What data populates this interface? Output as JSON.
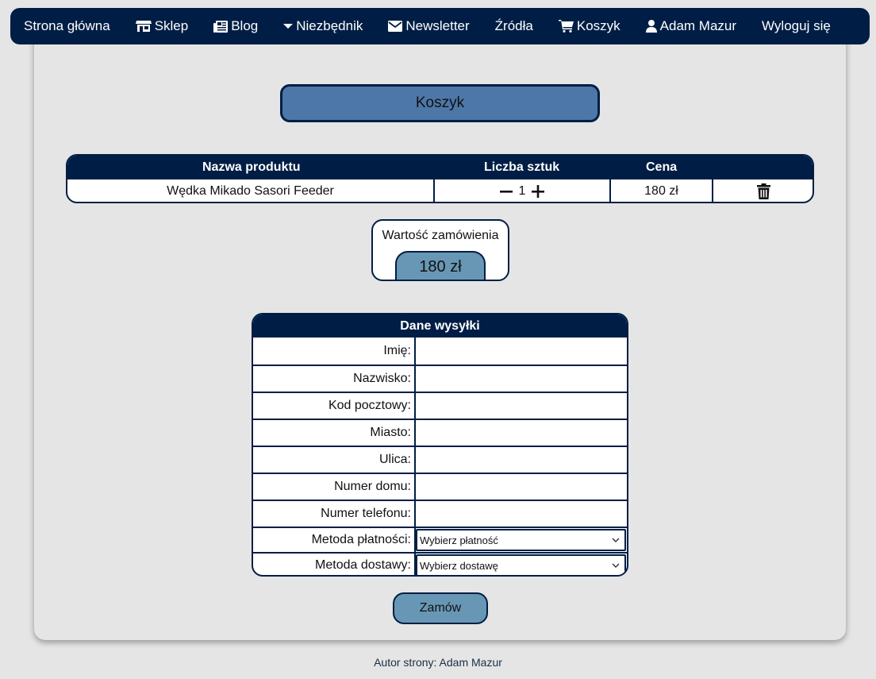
{
  "nav": {
    "items": [
      {
        "label": "Strona główna",
        "icon": ""
      },
      {
        "label": "Sklep",
        "icon": "store-icon"
      },
      {
        "label": "Blog",
        "icon": "newspaper-icon"
      },
      {
        "label": "Niezbędnik",
        "icon": "caret-down-icon"
      },
      {
        "label": "Newsletter",
        "icon": "envelope-icon"
      },
      {
        "label": "Źródła",
        "icon": ""
      },
      {
        "label": "Koszyk",
        "icon": "cart-icon"
      },
      {
        "label": "Adam Mazur",
        "icon": "user-icon"
      },
      {
        "label": "Wyloguj się",
        "icon": ""
      }
    ]
  },
  "page": {
    "title": "Koszyk"
  },
  "cart": {
    "headers": {
      "name": "Nazwa produktu",
      "qty": "Liczba sztuk",
      "price": "Cena"
    },
    "items": [
      {
        "name": "Wędka Mikado Sasori Feeder",
        "qty": "1",
        "price": "180 zł"
      }
    ]
  },
  "total": {
    "label": "Wartość zamówienia",
    "value": "180 zł"
  },
  "shipping": {
    "title": "Dane wysyłki",
    "fields": {
      "first_name": "Imię:",
      "last_name": "Nazwisko:",
      "postal_code": "Kod pocztowy:",
      "city": "Miasto:",
      "street": "Ulica:",
      "house_number": "Numer domu:",
      "phone": "Numer telefonu:",
      "payment": "Metoda płatności:",
      "delivery": "Metoda dostawy:"
    },
    "payment_selected": "Wybierz płatność",
    "delivery_selected": "Wybierz dostawę"
  },
  "submit_label": "Zamów",
  "footer": "Autor strony: Adam Mazur",
  "colors": {
    "navy": "#001e45",
    "title_blue": "#4d77a8",
    "button_blue": "#6897b5",
    "bg": "#e5e5e5"
  }
}
